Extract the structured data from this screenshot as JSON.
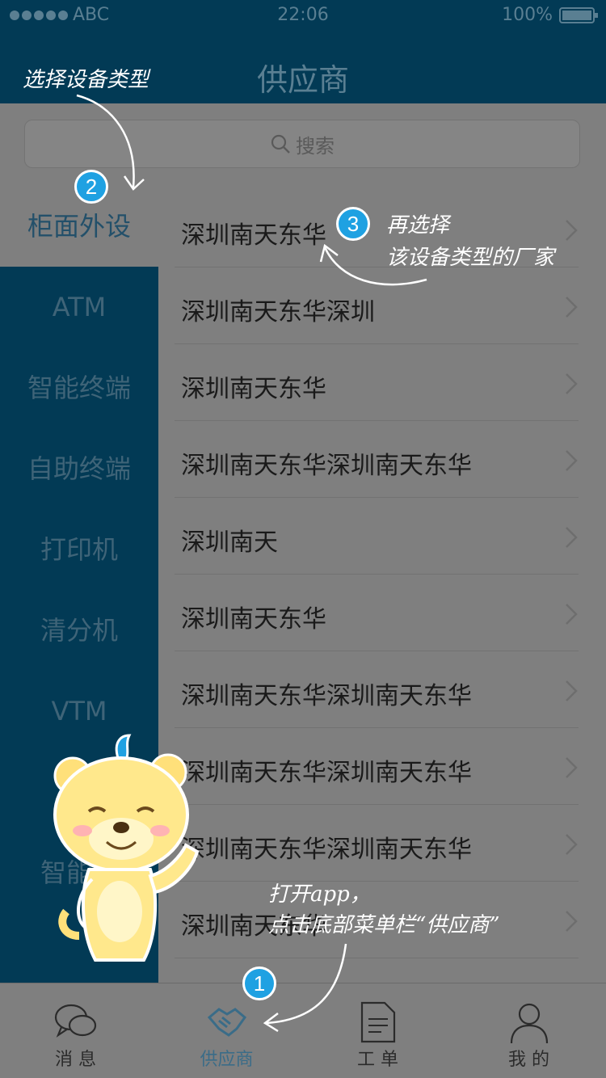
{
  "status": {
    "carrier": "ABC",
    "time": "22:06",
    "battery": "100%"
  },
  "header": {
    "title": "供应商"
  },
  "search": {
    "placeholder": "搜索"
  },
  "categories": [
    "柜面外设",
    "ATM",
    "智能终端",
    "自助终端",
    "打印机",
    "清分机",
    "VTM",
    "智能终"
  ],
  "vendors": [
    "深圳南天东华",
    "深圳南天东华深圳",
    "深圳南天东华",
    "深圳南天东华深圳南天东华",
    "深圳南天",
    "深圳南天东华",
    "深圳南天东华深圳南天东华",
    "深圳南天东华深圳南天东华",
    "深圳南天东华深圳南天东华",
    "深圳南天东华"
  ],
  "tabs": [
    {
      "label": "消 息",
      "icon": "chat-icon"
    },
    {
      "label": "供应商",
      "icon": "handshake-icon"
    },
    {
      "label": "工 单",
      "icon": "document-icon"
    },
    {
      "label": "我 的",
      "icon": "user-icon"
    }
  ],
  "annotations": {
    "step2_text": "选择设备类型",
    "step3_line1": "再选择",
    "step3_line2": "该设备类型的厂家",
    "step1_line1": "打开app，",
    "step1_line2": "点击底部菜单栏“供应商”",
    "badge1": "1",
    "badge2": "2",
    "badge3": "3"
  },
  "colors": {
    "header": "#023a55",
    "overlay": "#7f7f7f",
    "accent": "#1fa1e2"
  }
}
